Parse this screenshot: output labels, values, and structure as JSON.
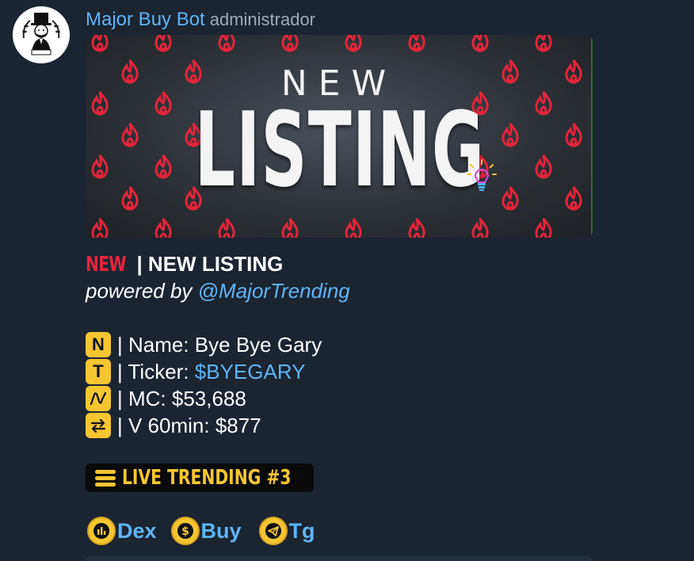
{
  "message": {
    "sender": "Major Buy Bot",
    "role": "administrador",
    "banner": {
      "word_top": "NEW",
      "word_main": "LISTING",
      "flame_color": "#e5243b"
    },
    "headline_tag": "NEW",
    "headline_text": "| NEW LISTING",
    "powered_prefix": "powered by",
    "powered_link": "@MajorTrending",
    "fields": [
      {
        "icon": "N",
        "icon_name": "letter-n-icon",
        "label": "| Name:",
        "value": "Bye Bye Gary",
        "value_is_link": false
      },
      {
        "icon": "T",
        "icon_name": "letter-t-icon",
        "label": "| Ticker:",
        "value": "$BYEGARY",
        "value_is_link": true
      },
      {
        "icon": "",
        "icon_name": "chart-wave-icon",
        "label": "| MC:",
        "value": "$53,688",
        "value_is_link": false
      },
      {
        "icon": "",
        "icon_name": "swap-arrows-icon",
        "label": "| V 60min:",
        "value": "$877",
        "value_is_link": false
      }
    ],
    "trending_label": "LIVE TRENDING #3",
    "actions": [
      {
        "label": "Dex",
        "icon_name": "chart-bars-icon"
      },
      {
        "label": "Buy",
        "icon_name": "dollar-coin-icon"
      },
      {
        "label": "Tg",
        "icon_name": "telegram-plane-icon"
      }
    ],
    "colors": {
      "background": "#1b2431",
      "link": "#5eb5f7",
      "accent_yellow": "#f6c532",
      "accent_red": "#e5243b"
    }
  }
}
